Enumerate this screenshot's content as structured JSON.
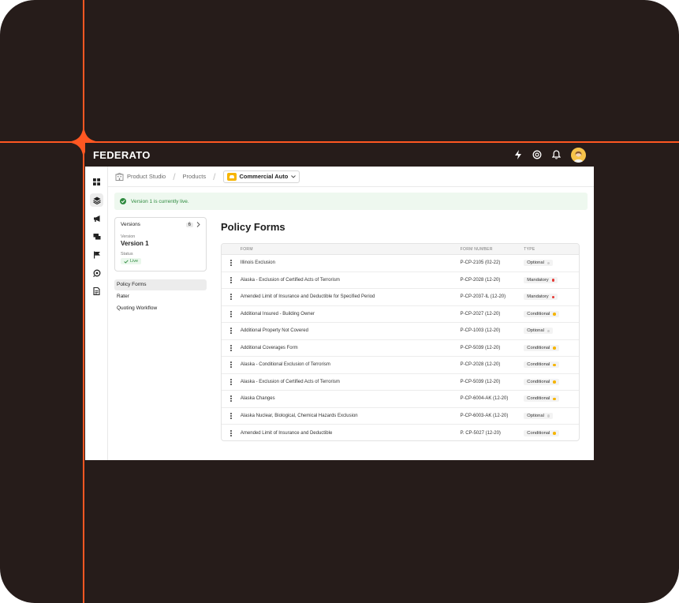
{
  "app": {
    "brand": "FEDERATO"
  },
  "breadcrumb": {
    "root": "Product Studio",
    "products": "Products",
    "product": "Commercial Auto"
  },
  "banner": {
    "text": "Version 1 is currently live."
  },
  "versions": {
    "title": "Versions",
    "count": "6",
    "version_label": "Version",
    "version_value": "Version 1",
    "status_label": "Status",
    "status_value": "Live"
  },
  "nav": {
    "items": [
      "Policy Forms",
      "Rater",
      "Quoting Workflow"
    ]
  },
  "page": {
    "title": "Policy Forms"
  },
  "table": {
    "headers": {
      "form": "FORM",
      "number": "FORM NUMBER",
      "type": "TYPE"
    },
    "type_colors": {
      "Optional": "#cfcfcf",
      "Mandatory": "#e53935",
      "Conditional": "#f5b400"
    },
    "rows": [
      {
        "form": "Illinois Exclusion",
        "number": "P-CP-2105 (02-22)",
        "type": "Optional"
      },
      {
        "form": "Alaska - Exclusion of Certified Acts of Terrorism",
        "number": "P-CP-2028 (12-20)",
        "type": "Mandatory"
      },
      {
        "form": "Amended Limit of Insurance and Deductible for Specified Period",
        "number": "P-CP-2037-IL (12-20)",
        "type": "Mandatory"
      },
      {
        "form": "Additional Insured - Building Owner",
        "number": "P-CP-2027 (12-20)",
        "type": "Conditional"
      },
      {
        "form": "Additional Property Not Covered",
        "number": "P-CP-1003 (12-20)",
        "type": "Optional"
      },
      {
        "form": "Additional Coverages Form",
        "number": "P-CP-5039 (12-20)",
        "type": "Conditional"
      },
      {
        "form": "Alaska - Conditional Exclusion of Terrorism",
        "number": "P-CP-2028 (12-20)",
        "type": "Conditional"
      },
      {
        "form": "Alaska - Exclusion of Certified Acts of Terrorism",
        "number": "P-CP-5039 (12-20)",
        "type": "Conditional"
      },
      {
        "form": "Alaska Changes",
        "number": "P-CP-6004-AK (12-20)",
        "type": "Conditional"
      },
      {
        "form": "Alaska Nuclear, Biological, Chemical Hazards Exclusion",
        "number": "P-CP-6003-AK (12-20)",
        "type": "Optional"
      },
      {
        "form": "Amended Limit of Insurance and Deductible",
        "number": "P. CP-5027 (12-20)",
        "type": "Conditional"
      }
    ]
  }
}
